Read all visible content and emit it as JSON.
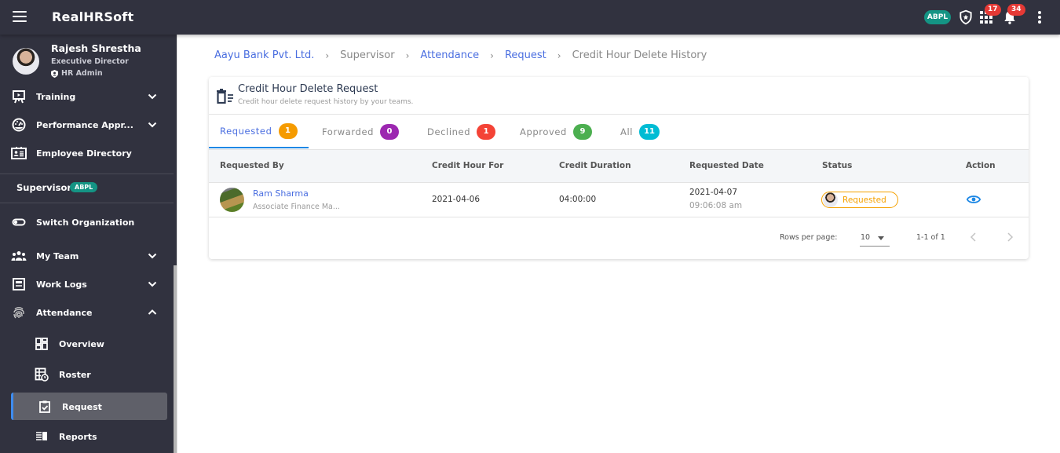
{
  "app": {
    "title": "RealHRSoft",
    "org_badge": "ABPL",
    "apps_badge_count": "17",
    "notifications_badge_count": "34",
    "colors": {
      "topbar": "#31323f",
      "sidebar": "#31323f",
      "accent": "#4a6ee0",
      "org_badge": "#149484",
      "badge": "#e53935"
    }
  },
  "profile": {
    "name": "Rajesh Shrestha",
    "designation": "Executive Director",
    "role": "HR Admin"
  },
  "sidebar": {
    "items": [
      {
        "label": "Training",
        "icon": "presentation-icon",
        "expandable": true
      },
      {
        "label": "Performance Appr...",
        "icon": "speedometer-icon",
        "expandable": true
      },
      {
        "label": "Employee Directory",
        "icon": "id-card-icon",
        "expandable": false
      }
    ],
    "section_label": "Supervisor",
    "section_badge": "ABPL",
    "switch_org": "Switch Organization",
    "supervisor_items": [
      {
        "label": "My Team",
        "icon": "team-icon",
        "expandable": true
      },
      {
        "label": "Work Logs",
        "icon": "worklog-icon",
        "expandable": true
      },
      {
        "label": "Attendance",
        "icon": "fingerprint-icon",
        "expanded": true
      }
    ],
    "attendance_sub": [
      {
        "label": "Overview",
        "icon": "dashboard-icon"
      },
      {
        "label": "Roster",
        "icon": "roster-icon"
      },
      {
        "label": "Request",
        "icon": "clipboard-check-icon",
        "active": true
      },
      {
        "label": "Reports",
        "icon": "reports-icon"
      }
    ]
  },
  "breadcrumb": [
    {
      "label": "Aayu Bank Pvt. Ltd.",
      "link": true
    },
    {
      "label": "Supervisor",
      "link": false
    },
    {
      "label": "Attendance",
      "link": true
    },
    {
      "label": "Request",
      "link": true
    },
    {
      "label": "Credit Hour Delete History",
      "link": false
    }
  ],
  "card": {
    "title": "Credit Hour Delete Request",
    "subtitle": "Credit hour delete request history by your teams."
  },
  "tabs": [
    {
      "label": "Requested",
      "count": "1",
      "color": "#f59b00",
      "active": true
    },
    {
      "label": "Forwarded",
      "count": "0",
      "color": "#9c27b0"
    },
    {
      "label": "Declined",
      "count": "1",
      "color": "#f44336"
    },
    {
      "label": "Approved",
      "count": "9",
      "color": "#4caf50"
    },
    {
      "label": "All",
      "count": "11",
      "color": "#00bcd4"
    }
  ],
  "table": {
    "columns": [
      "Requested By",
      "Credit Hour For",
      "Credit Duration",
      "Requested Date",
      "Status",
      "Action"
    ],
    "rows": [
      {
        "name": "Ram Sharma",
        "designation": "Associate Finance Ma...",
        "credit_hour_for": "2021-04-06",
        "credit_duration": "04:00:00",
        "requested_date": "2021-04-07",
        "requested_time": "09:06:08 am",
        "status": "Requested",
        "action_icon": "eye-icon"
      }
    ]
  },
  "pagination": {
    "rows_per_page_label": "Rows per page:",
    "rows_per_page": "10",
    "range": "1-1 of 1"
  }
}
